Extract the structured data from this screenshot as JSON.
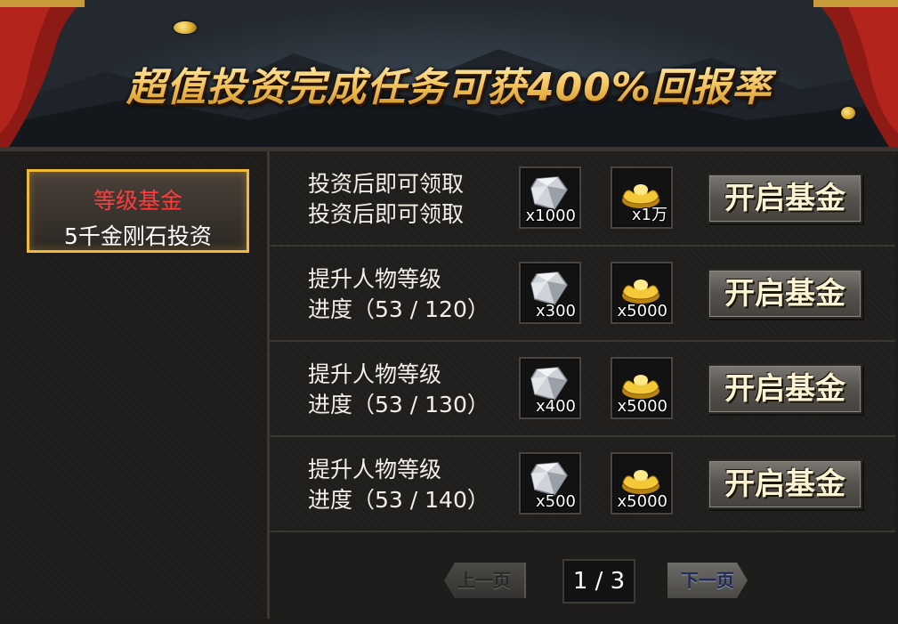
{
  "banner": {
    "title": "超值投资完成任务可获400%回报率"
  },
  "sidebar": {
    "tab": {
      "title": "等级基金",
      "subtitle": "5千金刚石投资"
    }
  },
  "rows": [
    {
      "line1": "投资后即可领取",
      "line2": "投资后即可领取",
      "diamond_qty": "x1000",
      "gold_qty": "x1万",
      "button": "开启基金"
    },
    {
      "line1": "提升人物等级",
      "line2": "进度（53 / 120）",
      "diamond_qty": "x300",
      "gold_qty": "x5000",
      "button": "开启基金"
    },
    {
      "line1": "提升人物等级",
      "line2": "进度（53 / 130）",
      "diamond_qty": "x400",
      "gold_qty": "x5000",
      "button": "开启基金"
    },
    {
      "line1": "提升人物等级",
      "line2": "进度（53 / 140）",
      "diamond_qty": "x500",
      "gold_qty": "x5000",
      "button": "开启基金"
    }
  ],
  "pager": {
    "prev": "上一页",
    "page": "1 / 3",
    "next": "下一页"
  },
  "icons": {
    "diamond": "diamond-icon",
    "gold": "gold-ingot-icon"
  },
  "colors": {
    "tab_border": "#f0b93a",
    "tab_title": "#ff3b3b",
    "banner_text": "#f2c25a"
  }
}
